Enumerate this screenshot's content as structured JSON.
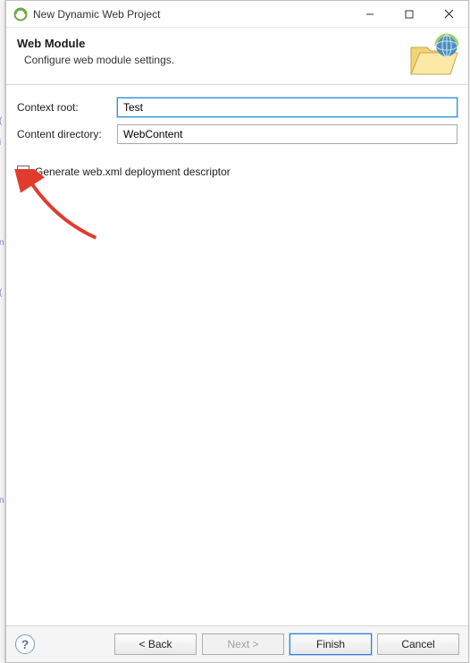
{
  "window": {
    "title": "New Dynamic Web Project"
  },
  "header": {
    "title": "Web Module",
    "subtitle": "Configure web module settings."
  },
  "form": {
    "context_root": {
      "label": "Context root:",
      "value": "Test"
    },
    "content_directory": {
      "label": "Content directory:",
      "value": "WebContent"
    },
    "generate_webxml": {
      "label": "Generate web.xml deployment descriptor",
      "checked": false
    }
  },
  "footer": {
    "back": "< Back",
    "next": "Next >",
    "finish": "Finish",
    "cancel": "Cancel"
  }
}
